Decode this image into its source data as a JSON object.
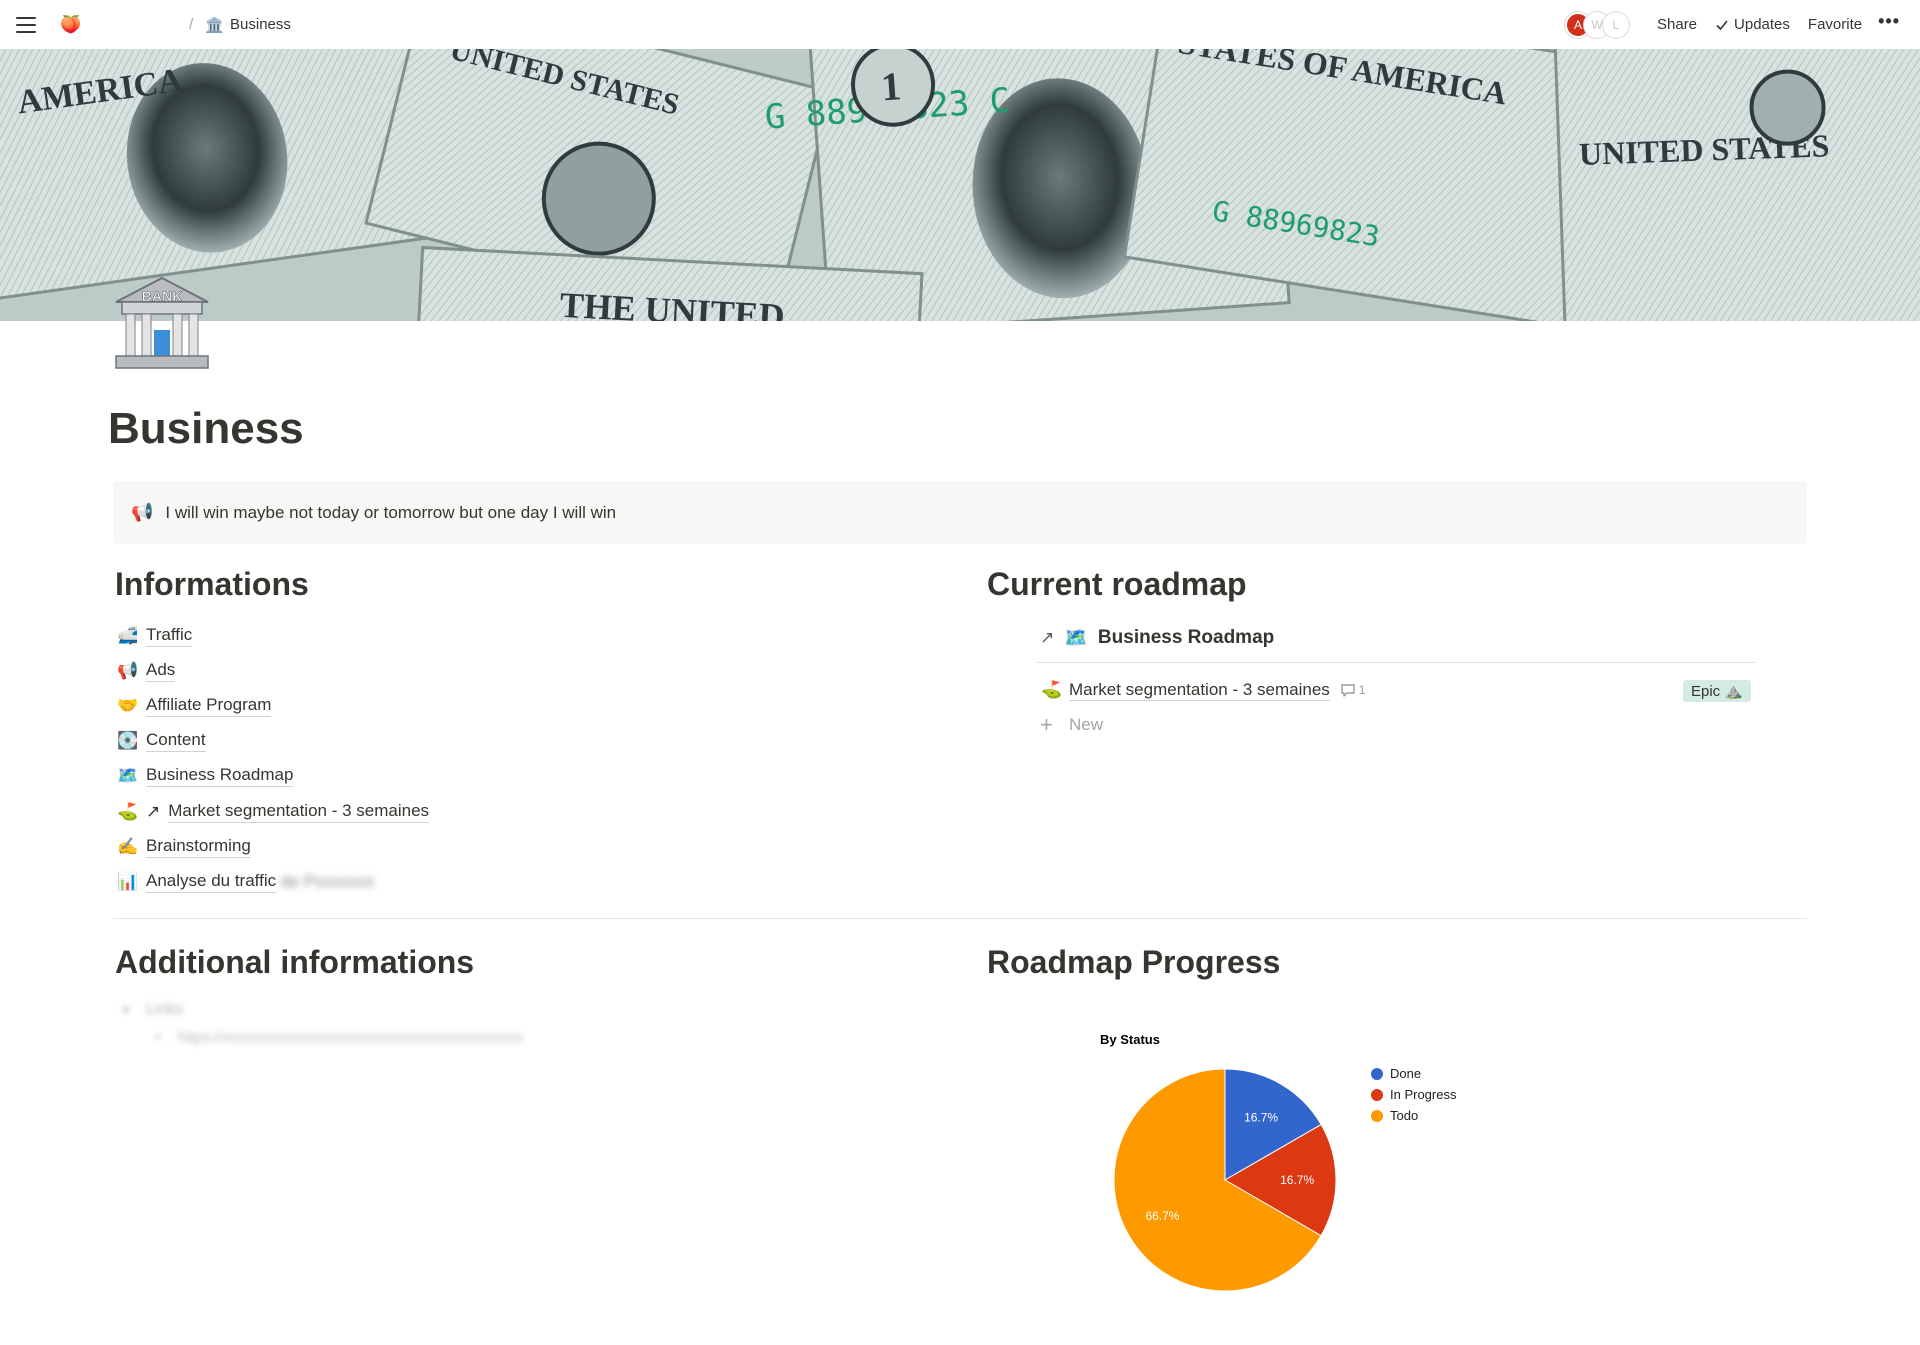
{
  "topbar": {
    "workspace_icon": "🍑",
    "breadcrumb_sep": "/",
    "breadcrumb_icon": "🏛️",
    "breadcrumb_label": "Business",
    "avatars": [
      "A",
      "W",
      "L"
    ],
    "share_label": "Share",
    "updates_label": "Updates",
    "favorite_label": "Favorite",
    "more_label": "•••"
  },
  "page": {
    "icon_label": "BANK",
    "title": "Business"
  },
  "callout": {
    "icon": "📢",
    "text": "I will win maybe not today or tomorrow but one day I will win"
  },
  "informations": {
    "heading": "Informations",
    "items": [
      {
        "emoji": "🚅",
        "label": "Traffic"
      },
      {
        "emoji": "📢",
        "label": "Ads"
      },
      {
        "emoji": "🤝",
        "label": "Affiliate Program"
      },
      {
        "emoji": "💽",
        "label": "Content"
      },
      {
        "emoji": "🗺️",
        "label": "Business Roadmap"
      },
      {
        "emoji": "⛳",
        "arrow": "↗",
        "label": "Market segmentation - 3 semaines"
      },
      {
        "emoji": "✍️",
        "label": "Brainstorming"
      },
      {
        "emoji": "📊",
        "label": "Analyse du traffic",
        "suffix": "de Pxxxxxxx"
      }
    ]
  },
  "roadmap": {
    "heading": "Current roadmap",
    "arrow": "↗",
    "db_icon": "🗺️",
    "db_title": "Business Roadmap",
    "row": {
      "emoji": "⛳",
      "label": "Market segmentation - 3 semaines",
      "comment_count": "1",
      "tag": "Epic ⛰️"
    },
    "new_label": "New"
  },
  "additional": {
    "heading": "Additional informations",
    "toggle_label": "Links",
    "toggle_item": "https://xxxxxxxxxxxxxxxxxxxxxxxxxxxxxxxxxxxxxxxx"
  },
  "progress": {
    "heading": "Roadmap Progress"
  },
  "chart_data": {
    "type": "pie",
    "title": "By Status",
    "legend_position": "right",
    "slices": [
      {
        "name": "Done",
        "value": 16.7,
        "label": "16.7%",
        "color": "#3366cc"
      },
      {
        "name": "In Progress",
        "value": 16.7,
        "label": "16.7%",
        "color": "#dc3912"
      },
      {
        "name": "Todo",
        "value": 66.7,
        "label": "66.7%",
        "color": "#ff9900"
      }
    ]
  }
}
